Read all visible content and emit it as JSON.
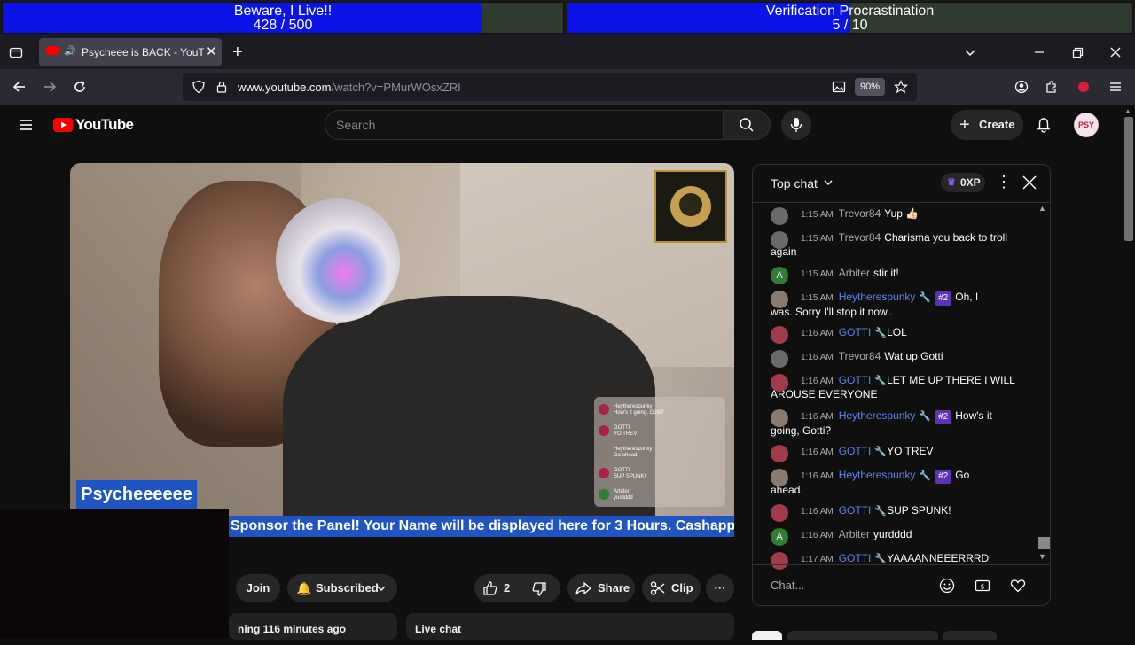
{
  "goals": [
    {
      "title": "Beware, I Live!!",
      "progress_text": "428 / 500",
      "fraction": 0.856
    },
    {
      "title": "Verification Procrastination",
      "progress_text": "5 / 10",
      "fraction": 0.5
    }
  ],
  "browser": {
    "tab_title": "Psycheee is BACK - YouTube",
    "url_host": "www.youtube.com",
    "url_path": "/watch?v=PMurWOsxZRI",
    "zoom": "90%",
    "new_tab": "+"
  },
  "youtube": {
    "logo_text": "YouTube",
    "search_placeholder": "Search",
    "create_label": "Create",
    "avatar_text": "PSY"
  },
  "video": {
    "ticker_text": "Sponsor the Panel! Your Name will be displayed here for 3 Hours. Cashapp $Psyc",
    "streamer_name": "Psycheeeeee",
    "minichat": [
      {
        "author": "Heytherespunky",
        "text": "How's it going, Gotti?"
      },
      {
        "author": "GOTTI",
        "text": "YO TREV"
      },
      {
        "author": "Heytherespunky",
        "text": "Go ahead."
      },
      {
        "author": "GOTTI",
        "text": "SUP SPUNK!"
      },
      {
        "author": "Arbiter",
        "text": "yurdddd"
      }
    ]
  },
  "actions": {
    "join": "Join",
    "subscribed": "Subscribed",
    "likes": "2",
    "share": "Share",
    "clip": "Clip",
    "streaming_text": "ning 116 minutes ago",
    "live_chat_card": "Live chat"
  },
  "chat": {
    "header": "Top chat",
    "xp": "0XP",
    "input_placeholder": "Chat...",
    "messages": [
      {
        "time": "1:15 AM",
        "author": "Trevor84",
        "text": "Yup 👍🏻",
        "avatar_color": "#6a6a6a",
        "mod": false
      },
      {
        "time": "1:15 AM",
        "author": "Trevor84",
        "text": "Charisma you back to troll",
        "cont": "again",
        "avatar_color": "#6a6a6a",
        "mod": false
      },
      {
        "time": "1:15 AM",
        "author": "Arbiter",
        "text": "stir it!",
        "avatar_color": "#2e7d32",
        "initial": "A",
        "mod": false
      },
      {
        "time": "1:15 AM",
        "author": "Heytherespunky",
        "text": "Oh, I",
        "cont": "was. Sorry I'll stop it now..",
        "badge": "#2",
        "avatar_color": "#8a7a70",
        "mod": true
      },
      {
        "time": "1:16 AM",
        "author": "GOTTI",
        "text": "LOL",
        "avatar_color": "#a33a4a",
        "mod": true
      },
      {
        "time": "1:16 AM",
        "author": "Trevor84",
        "text": "Wat up Gotti",
        "avatar_color": "#6a6a6a",
        "mod": false
      },
      {
        "time": "1:16 AM",
        "author": "GOTTI",
        "text": "LET ME UP THERE I WILL",
        "cont": "AROUSE EVERYONE",
        "avatar_color": "#a33a4a",
        "mod": true
      },
      {
        "time": "1:16 AM",
        "author": "Heytherespunky",
        "text": "How's it",
        "cont": "going, Gotti?",
        "badge": "#2",
        "avatar_color": "#8a7a70",
        "mod": true
      },
      {
        "time": "1:16 AM",
        "author": "GOTTI",
        "text": "YO TREV",
        "avatar_color": "#a33a4a",
        "mod": true
      },
      {
        "time": "1:16 AM",
        "author": "Heytherespunky",
        "text": "Go",
        "cont": "ahead.",
        "badge": "#2",
        "avatar_color": "#8a7a70",
        "mod": true
      },
      {
        "time": "1:16 AM",
        "author": "GOTTI",
        "text": "SUP SPUNK!",
        "avatar_color": "#a33a4a",
        "mod": true
      },
      {
        "time": "1:16 AM",
        "author": "Arbiter",
        "text": "yurdddd",
        "avatar_color": "#2e7d32",
        "initial": "A",
        "mod": false
      },
      {
        "time": "1:17 AM",
        "author": "GOTTI",
        "text": "YAAAANNEEERRRD",
        "avatar_color": "#a33a4a",
        "mod": true
      }
    ]
  }
}
